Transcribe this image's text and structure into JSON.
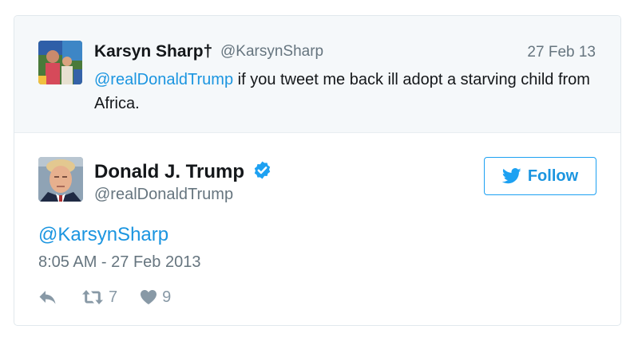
{
  "parent_tweet": {
    "author_name": "Karsyn Sharp†",
    "author_handle": "@KarsynSharp",
    "date": "27 Feb 13",
    "mention": "@realDonaldTrump",
    "body": " if you tweet me back ill adopt a starving child from Africa."
  },
  "tweet": {
    "author_name": "Donald J. Trump",
    "author_handle": "@realDonaldTrump",
    "text": "@KarsynSharp",
    "timestamp": "8:05 AM - 27 Feb 2013",
    "retweets": "7",
    "likes": "9"
  },
  "follow_label": "Follow",
  "colors": {
    "link": "#1b95e0",
    "verified": "#1da1f2",
    "muted": "#66757f",
    "action": "#8899a6",
    "parent_bg": "#f5f8fa"
  },
  "icons": [
    "reply-icon",
    "retweet-icon",
    "heart-icon",
    "twitter-bird-icon",
    "verified-badge-icon"
  ]
}
